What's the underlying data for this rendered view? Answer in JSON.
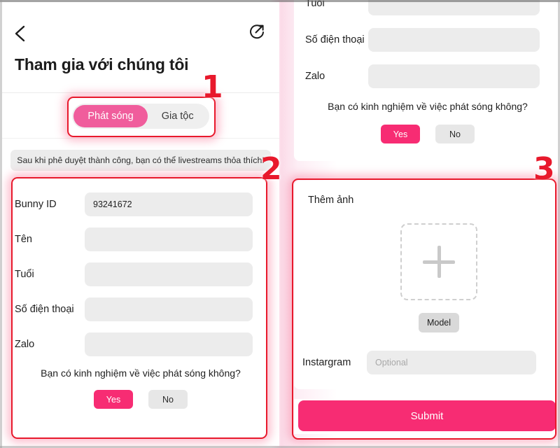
{
  "app": {
    "title": "Tham gia với chúng tôi",
    "back_icon": "chevron-left-icon",
    "share_icon": "share-circle-icon"
  },
  "tabs": {
    "items": [
      {
        "label": "Phát sóng",
        "active": true
      },
      {
        "label": "Gia tộc",
        "active": false
      }
    ]
  },
  "banner": {
    "text": "Sau khi phê duyệt thành công, bạn có thể livestreams thỏa thích!"
  },
  "form_main": {
    "fields": [
      {
        "label": "Bunny ID",
        "value": "93241672",
        "placeholder": ""
      },
      {
        "label": "Tên",
        "value": "",
        "placeholder": ""
      },
      {
        "label": "Tuổi",
        "value": "",
        "placeholder": ""
      },
      {
        "label": "Số điện thoại",
        "value": "",
        "placeholder": ""
      },
      {
        "label": "Zalo",
        "value": "",
        "placeholder": ""
      }
    ],
    "question": "Bạn có kinh nghiệm về việc phát sóng không?",
    "yes_label": "Yes",
    "no_label": "No"
  },
  "form_continued": {
    "fields": [
      {
        "label": "Tuổi",
        "value": ""
      },
      {
        "label": "Số điện thoại",
        "value": ""
      },
      {
        "label": "Zalo",
        "value": ""
      }
    ],
    "question": "Bạn có kinh nghiệm về việc phát sóng không?",
    "yes_label": "Yes",
    "no_label": "No"
  },
  "photo": {
    "title": "Thêm ảnh",
    "add_icon": "plus-icon",
    "model_label": "Model",
    "instagram_label": "Instargram",
    "instagram_placeholder": "Optional"
  },
  "submit": {
    "label": "Submit"
  },
  "annotations": {
    "markers": [
      {
        "number": "1"
      },
      {
        "number": "2"
      },
      {
        "number": "3"
      }
    ]
  },
  "colors": {
    "accent_pink": "#f72c73",
    "tab_pink": "#f05d9c",
    "annotation_red": "#e8192c",
    "input_gray": "#ececec",
    "backdrop_pink": "#fbdbe8"
  }
}
